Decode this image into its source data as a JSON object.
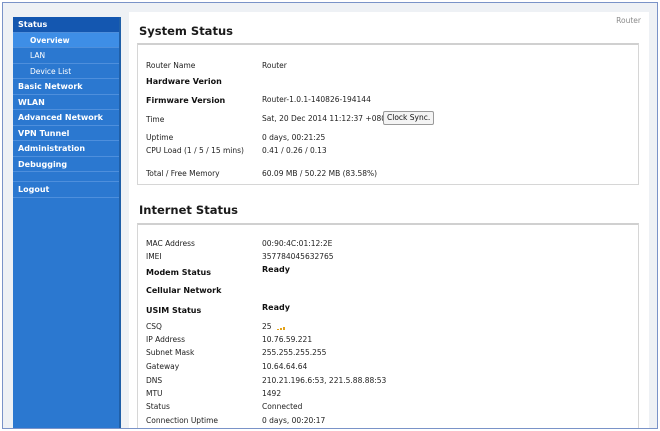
{
  "breadcrumb": "Router",
  "sidebar": {
    "items": [
      {
        "label": "Status",
        "active": true
      },
      {
        "label": "Overview",
        "sub": true,
        "active": true
      },
      {
        "label": "LAN",
        "sub": true
      },
      {
        "label": "Device List",
        "sub": true
      },
      {
        "label": "Basic Network"
      },
      {
        "label": "WLAN"
      },
      {
        "label": "Advanced Network"
      },
      {
        "label": "VPN Tunnel"
      },
      {
        "label": "Administration"
      },
      {
        "label": "Debugging"
      },
      {
        "label": "Logout"
      }
    ]
  },
  "system_status": {
    "title": "System Status",
    "rows": [
      {
        "label": "Router Name",
        "value": "Router"
      },
      {
        "label": "Hardware Verion",
        "value": ""
      },
      {
        "label": "Firmware Version",
        "value": "Router-1.0.1-140826-194144"
      },
      {
        "label": "Time",
        "value": "Sat, 20 Dec 2014 11:12:37 +0800"
      },
      {
        "label": "Uptime",
        "value": "0 days, 00:21:25"
      },
      {
        "label": "CPU Load (1 / 5 / 15 mins)",
        "value": "0.41 / 0.26 / 0.13"
      },
      {
        "label": "Total / Free Memory",
        "value": "60.09 MB / 50.22 MB (83.58%)"
      }
    ],
    "clock_sync_label": "Clock Sync."
  },
  "internet_status": {
    "title": "Internet Status",
    "rows": [
      {
        "label": "MAC Address",
        "value": "00:90:4C:01:12:2E"
      },
      {
        "label": "IMEI",
        "value": "357784045632765"
      },
      {
        "label": "Modem Status",
        "value": "Ready"
      },
      {
        "label": "Cellular Network",
        "value": ""
      },
      {
        "label": "USIM Status",
        "value": "Ready"
      },
      {
        "label": "CSQ",
        "value": "25"
      },
      {
        "label": "IP Address",
        "value": "10.76.59.221"
      },
      {
        "label": "Subnet Mask",
        "value": "255.255.255.255"
      },
      {
        "label": "Gateway",
        "value": "10.64.64.64"
      },
      {
        "label": "DNS",
        "value": "210.21.196.6:53, 221.5.88.88:53"
      },
      {
        "label": "MTU",
        "value": "1492"
      },
      {
        "label": "Status",
        "value": "Connected"
      },
      {
        "label": "Connection Uptime",
        "value": "0 days, 00:20:17"
      }
    ]
  },
  "colors": {
    "sidebar_bg": "#2b78d0",
    "sidebar_active": "#1457b0",
    "signal": "#e3a21a"
  }
}
